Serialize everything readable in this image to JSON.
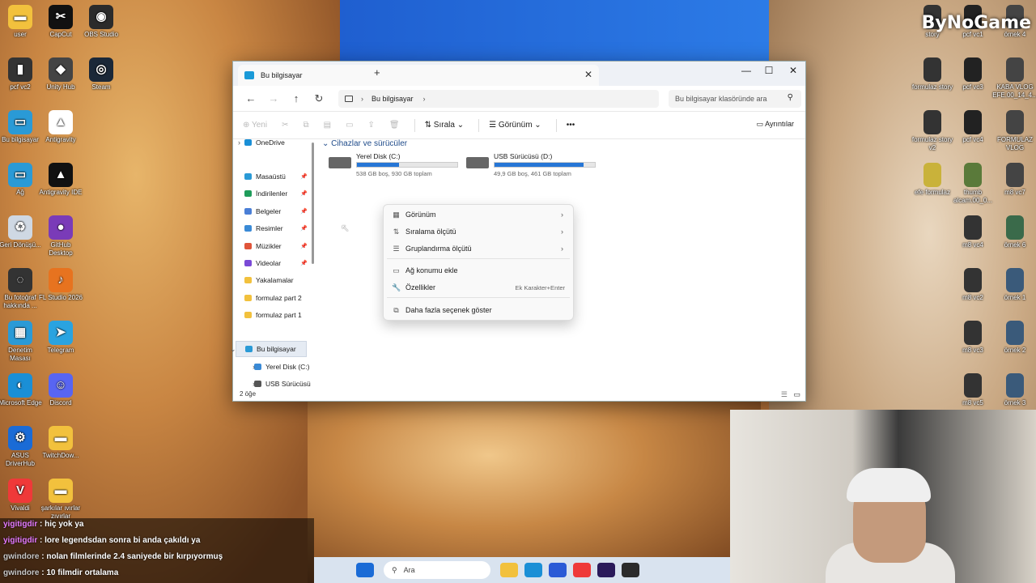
{
  "brand_logo": "ByNoGame",
  "desktop_left": [
    {
      "label": "user",
      "color": "#f2c13d",
      "glyph": "▬"
    },
    {
      "label": "CapCut",
      "color": "#111111",
      "glyph": "✂"
    },
    {
      "label": "OBS Studio",
      "color": "#2b2b2b",
      "glyph": "◉"
    },
    {
      "label": "pcf vc2",
      "color": "#333333",
      "glyph": "▮"
    },
    {
      "label": "Unity Hub",
      "color": "#444444",
      "glyph": "◆"
    },
    {
      "label": "Steam",
      "color": "#1b2838",
      "glyph": "◎"
    },
    {
      "label": "Bu bilgisayar",
      "color": "#2a9ad6",
      "glyph": "▭"
    },
    {
      "label": "Antigravity",
      "color": "#ffffff",
      "glyph": "▲"
    },
    {
      "label": "Ağ",
      "color": "#2a9ad6",
      "glyph": "▭"
    },
    {
      "label": "Antigravity IDE",
      "color": "#111111",
      "glyph": "▲"
    },
    {
      "label": "Geri Dönüşü...",
      "color": "#cfd8e3",
      "glyph": "♻"
    },
    {
      "label": "GitHub Desktop",
      "color": "#7a3bb8",
      "glyph": "●"
    },
    {
      "label": "Bu fotoğraf hakkında ...",
      "color": "#333333",
      "glyph": "◌"
    },
    {
      "label": "FL Studio 2026",
      "color": "#e7731f",
      "glyph": "♪"
    },
    {
      "label": "Denetim Masası",
      "color": "#2a9ad6",
      "glyph": "▦"
    },
    {
      "label": "Telegram",
      "color": "#2aa3e0",
      "glyph": "➤"
    },
    {
      "label": "Microsoft Edge",
      "color": "#1a8fd6",
      "glyph": "◐"
    },
    {
      "label": "Discord",
      "color": "#5865f2",
      "glyph": "☺"
    },
    {
      "label": "ASUS DriverHub",
      "color": "#1a6bd6",
      "glyph": "⚙"
    },
    {
      "label": "TwitchDow...",
      "color": "#f2c13d",
      "glyph": "▬"
    },
    {
      "label": "Vivaldi",
      "color": "#ef3939",
      "glyph": "V"
    },
    {
      "label": "şarkılar ıvırlar zıvırlar",
      "color": "#f2c13d",
      "glyph": "▬"
    }
  ],
  "desktop_right": [
    {
      "label": "story",
      "color": "#333333"
    },
    {
      "label": "pcf vc1",
      "color": "#222222"
    },
    {
      "label": "örnek 4",
      "color": "#444444"
    },
    {
      "label": "formulaz story",
      "color": "#333333"
    },
    {
      "label": "pcf vc3",
      "color": "#222222"
    },
    {
      "label": "KABA VLOG EFE.00_14_4...",
      "color": "#444444"
    },
    {
      "label": "formulaz story v2",
      "color": "#333333"
    },
    {
      "label": "pcf vc4",
      "color": "#222222"
    },
    {
      "label": "FORMULAZ VLOG",
      "color": "#444444"
    },
    {
      "label": "efe formulaz",
      "color": "#c9b23a"
    },
    {
      "label": "thumb alcam.00_0...",
      "color": "#5a7a3a"
    },
    {
      "label": "m8 vc7",
      "color": "#444444"
    },
    {
      "label": "m8 vc4",
      "color": "#333333"
    },
    {
      "label": "örnek 6",
      "color": "#3a6a4a"
    },
    {
      "label": "m8 vc2",
      "color": "#333333"
    },
    {
      "label": "örnek 1",
      "color": "#3a5a7a"
    },
    {
      "label": "m8 vc3",
      "color": "#333333"
    },
    {
      "label": "örnek 2",
      "color": "#3a5a7a"
    },
    {
      "label": "m8 vc5",
      "color": "#333333"
    },
    {
      "label": "örnek 3",
      "color": "#3a5a7a"
    }
  ],
  "explorer": {
    "tab_title": "Bu bilgisayar",
    "address_path": "Bu bilgisayar",
    "search_placeholder": "Bu bilgisayar klasöründe ara",
    "cmd": {
      "new": "Yeni",
      "sort": "Sırala",
      "view": "Görünüm",
      "more": "•••",
      "details": "Ayrıntılar"
    },
    "sidebar": [
      {
        "label": "OneDrive",
        "color": "#1a8fd6",
        "pinned": false,
        "expand": true
      },
      {
        "label": "Masaüstü",
        "color": "#2a9ad6",
        "pinned": true
      },
      {
        "label": "İndirilenler",
        "color": "#1e9c5a",
        "pinned": true
      },
      {
        "label": "Belgeler",
        "color": "#4a7fd6",
        "pinned": true
      },
      {
        "label": "Resimler",
        "color": "#3a8ad6",
        "pinned": true
      },
      {
        "label": "Müzikler",
        "color": "#e0553a",
        "pinned": true
      },
      {
        "label": "Videolar",
        "color": "#7a4ad6",
        "pinned": true
      },
      {
        "label": "Yakalamalar",
        "color": "#f2c13d",
        "pinned": false
      },
      {
        "label": "formulaz part 2",
        "color": "#f2c13d",
        "pinned": false
      },
      {
        "label": "formulaz part 1",
        "color": "#f2c13d",
        "pinned": false
      },
      {
        "label": "Bu bilgisayar",
        "color": "#2a9ad6",
        "pinned": false,
        "selected": true
      },
      {
        "label": "Yerel Disk (C:)",
        "color": "#3a8ad6",
        "pinned": false
      },
      {
        "label": "USB Sürücüsü",
        "color": "#555555",
        "pinned": false
      }
    ],
    "section_title": "Cihazlar ve sürücüler",
    "drives": [
      {
        "name": "Yerel Disk (C:)",
        "free_text": "538 GB boş, 930 GB toplam",
        "used_fraction": 0.42
      },
      {
        "name": "USB Sürücüsü (D:)",
        "free_text": "49,9 GB boş, 461 GB toplam",
        "used_fraction": 0.89
      }
    ],
    "status": "2 öğe"
  },
  "context_menu": [
    {
      "label": "Görünüm",
      "icon": "▦",
      "submenu": true
    },
    {
      "label": "Sıralama ölçütü",
      "icon": "⇅",
      "submenu": true
    },
    {
      "label": "Gruplandırma ölçütü",
      "icon": "☰",
      "submenu": true
    },
    {
      "label": "Ağ konumu ekle",
      "icon": "▭",
      "submenu": false
    },
    {
      "label": "Özellikler",
      "icon": "🔧",
      "submenu": false,
      "shortcut": "Ek Karakter+Enter"
    },
    {
      "label": "Daha fazla seçenek göster",
      "icon": "⧉",
      "submenu": false
    }
  ],
  "chat": [
    {
      "user": "yigitigdir",
      "message": ": hiç yok ya",
      "userColor": "u1"
    },
    {
      "user": "yigitigdir",
      "message": ": lore legendsdan sonra bi anda çakıldı ya",
      "userColor": "u1"
    },
    {
      "user": "gwindore",
      "message": ": nolan filmlerinde 2.4 saniyede bir kırpıyormuş",
      "userColor": "u2"
    },
    {
      "user": "gwindore",
      "message": ": 10 filmdir ortalama",
      "userColor": "u2"
    }
  ],
  "taskbar": {
    "search_label": "Ara",
    "icons": [
      {
        "name": "start-icon",
        "color": "#1a6bd6"
      },
      {
        "name": "file-explorer-icon",
        "color": "#f2c13d"
      },
      {
        "name": "edge-icon",
        "color": "#1a8fd6"
      },
      {
        "name": "store-icon",
        "color": "#2a5ad6"
      },
      {
        "name": "vivaldi-icon",
        "color": "#ef3939"
      },
      {
        "name": "premiere-icon",
        "color": "#2a1a5a"
      },
      {
        "name": "obs-icon",
        "color": "#2b2b2b"
      }
    ]
  }
}
